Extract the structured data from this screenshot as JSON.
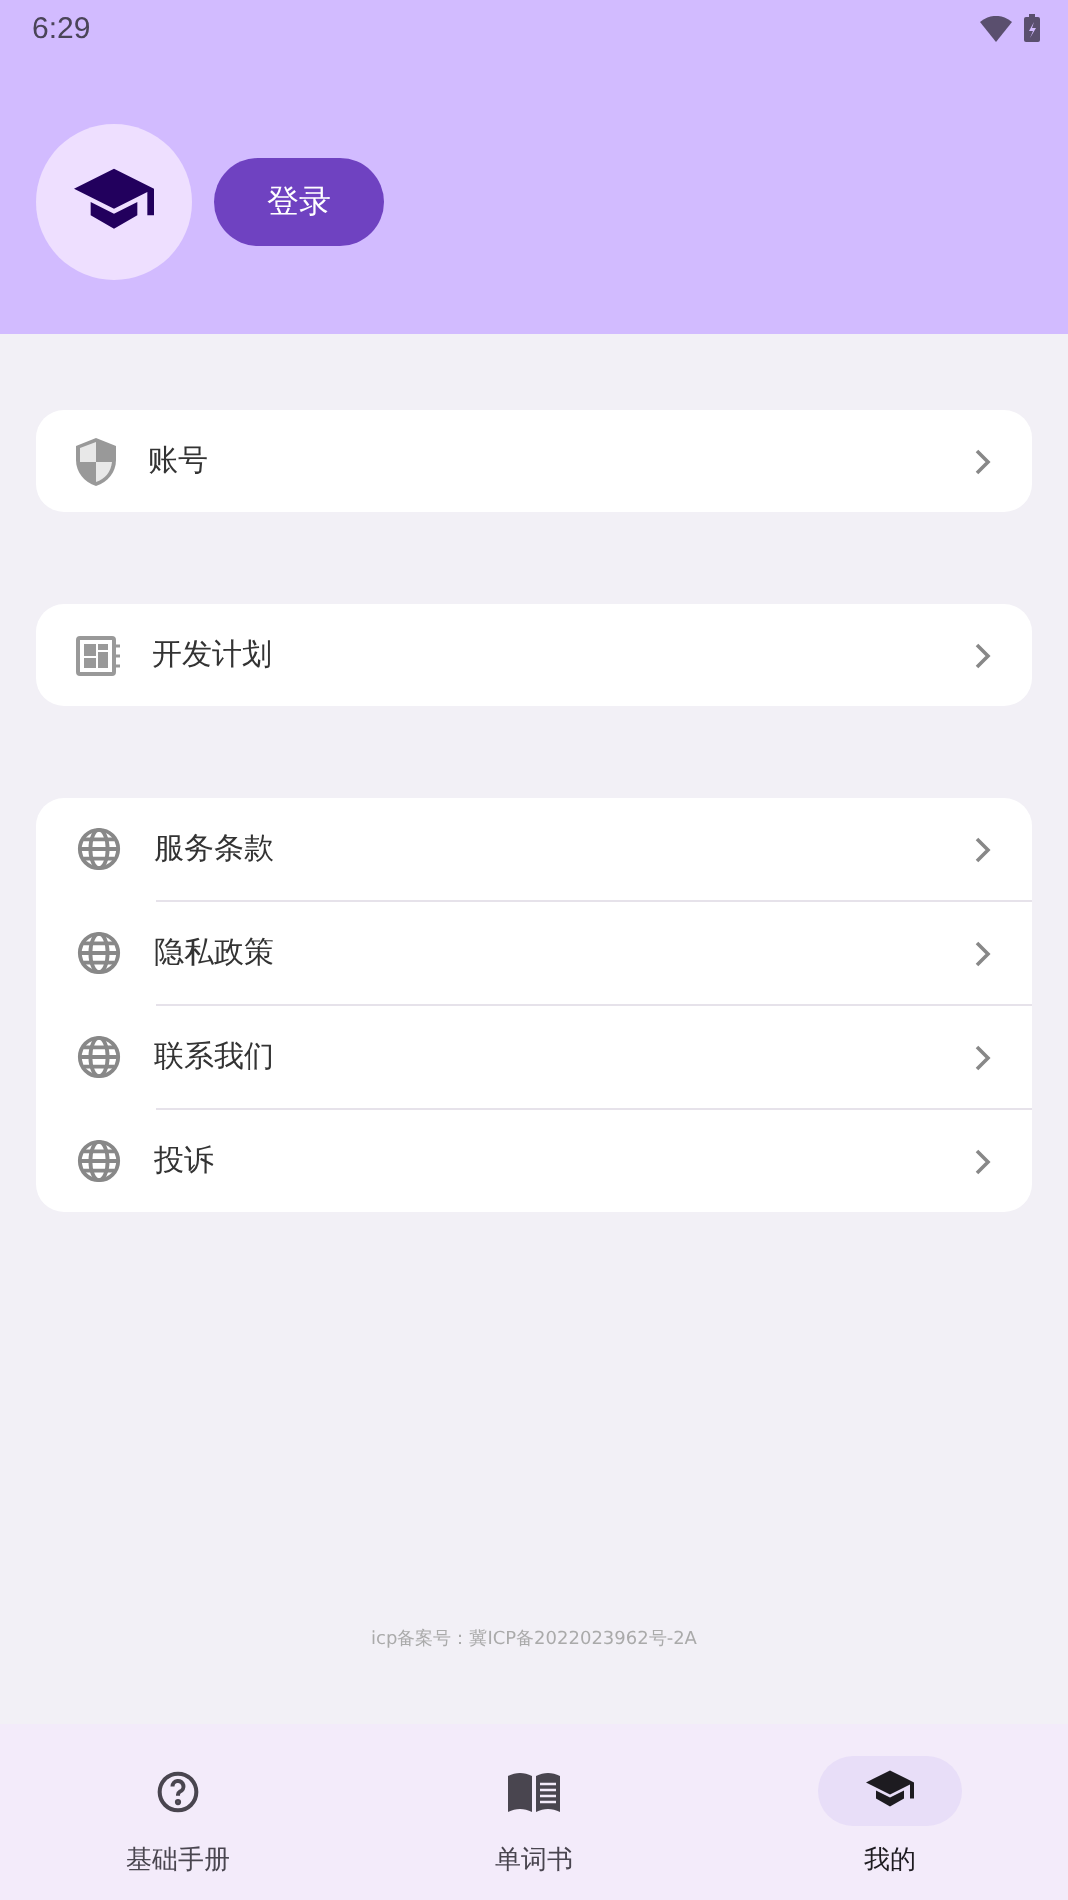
{
  "status_bar": {
    "time": "6:29"
  },
  "header": {
    "login_button": "登录"
  },
  "groups": [
    {
      "items": [
        {
          "kind": "shield",
          "label": "账号"
        }
      ]
    },
    {
      "items": [
        {
          "kind": "plan",
          "label": "开发计划"
        }
      ]
    },
    {
      "items": [
        {
          "kind": "globe",
          "label": "服务条款"
        },
        {
          "kind": "globe",
          "label": "隐私政策"
        },
        {
          "kind": "globe",
          "label": "联系我们"
        },
        {
          "kind": "globe",
          "label": "投诉"
        }
      ]
    }
  ],
  "footer_note": "icp备案号：冀ICP备2022023962号-2A",
  "bottom_nav": [
    {
      "kind": "help",
      "label": "基础手册",
      "selected": false
    },
    {
      "kind": "book",
      "label": "单词书",
      "selected": false
    },
    {
      "kind": "cap",
      "label": "我的",
      "selected": true
    }
  ]
}
